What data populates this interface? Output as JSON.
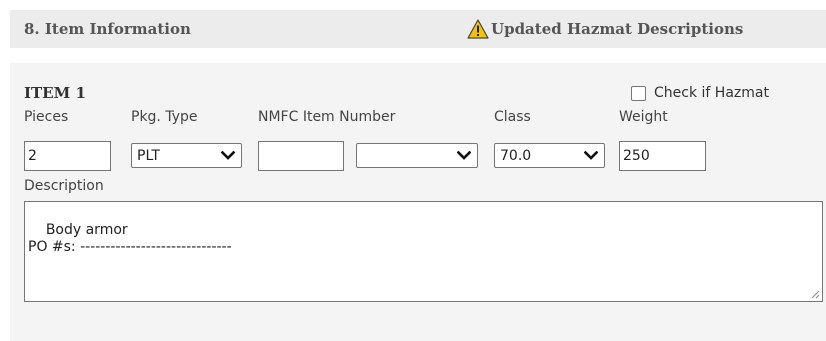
{
  "section": {
    "title": "8. Item Information",
    "hazmat_link_label": "Updated Hazmat Descriptions"
  },
  "item": {
    "title": "ITEM 1",
    "hazmat_checkbox_label": "Check if Hazmat",
    "hazmat_checked": false,
    "labels": {
      "pieces": "Pieces",
      "pkg_type": "Pkg. Type",
      "nmfc": "NMFC Item Number",
      "class": "Class",
      "weight": "Weight",
      "description": "Description"
    },
    "values": {
      "pieces": "2",
      "pkg_type": "PLT",
      "nmfc_number": "",
      "nmfc_sub": "",
      "class": "70.0",
      "weight": "250",
      "description": "Body armor\nPO #s: ------------------------------"
    }
  },
  "colors": {
    "header_bg": "#ececec",
    "panel_bg": "#f4f4f4",
    "warning_yellow": "#f5c400"
  },
  "icons": {
    "warning": "warning-triangle-icon",
    "dropdown": "chevron-down-icon",
    "resize": "resize-grip-icon"
  }
}
